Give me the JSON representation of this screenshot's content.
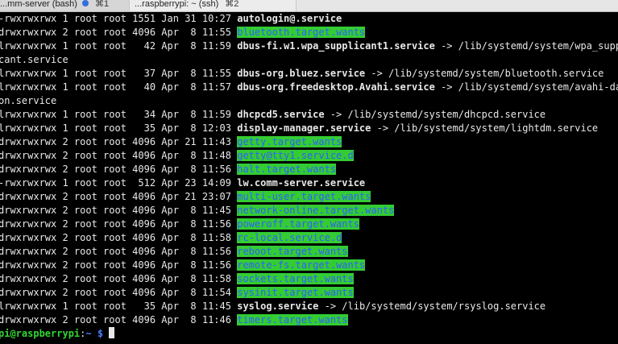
{
  "tabs": [
    {
      "title": "...mm-server (bash)",
      "shortcut": "⌘1"
    },
    {
      "title": "...raspberrypi: ~ (ssh)",
      "shortcut": "⌘2"
    }
  ],
  "colors": {
    "terminal_bg": "#000000",
    "text": "#e8e8e8",
    "dir_highlight": "#33cc33",
    "dir_text": "#2f5fff",
    "prompt_user": "#33d633",
    "prompt_path": "#4a7dff"
  },
  "lines": [
    {
      "prefix": "-rwxrwxrwx 1 root root 1551 Jan 31 10:27 ",
      "name": "autologin@.service",
      "type": "bold",
      "suffix": ""
    },
    {
      "prefix": "drwxrwxrwx 2 root root 4096 Apr  8 11:55 ",
      "name": "bluetooth.target.wants",
      "type": "dir",
      "suffix": ""
    },
    {
      "prefix": "lrwxrwxrwx 1 root root   42 Apr  8 11:59 ",
      "name": "dbus-fi.w1.wpa_supplicant1.service",
      "type": "link",
      "suffix": " -> /lib/systemd/system/wpa_suppli"
    },
    {
      "prefix": "cant.service",
      "name": "",
      "type": "plain",
      "suffix": ""
    },
    {
      "prefix": "lrwxrwxrwx 1 root root   37 Apr  8 11:55 ",
      "name": "dbus-org.bluez.service",
      "type": "link",
      "suffix": " -> /lib/systemd/system/bluetooth.service"
    },
    {
      "prefix": "lrwxrwxrwx 1 root root   40 Apr  8 11:57 ",
      "name": "dbus-org.freedesktop.Avahi.service",
      "type": "link",
      "suffix": " -> /lib/systemd/system/avahi-daem"
    },
    {
      "prefix": "on.service",
      "name": "",
      "type": "plain",
      "suffix": ""
    },
    {
      "prefix": "lrwxrwxrwx 1 root root   34 Apr  8 11:59 ",
      "name": "dhcpcd5.service",
      "type": "link",
      "suffix": " -> /lib/systemd/system/dhcpcd.service"
    },
    {
      "prefix": "lrwxrwxrwx 1 root root   35 Apr  8 12:03 ",
      "name": "display-manager.service",
      "type": "link",
      "suffix": " -> /lib/systemd/system/lightdm.service"
    },
    {
      "prefix": "drwxrwxrwx 2 root root 4096 Apr 21 11:43 ",
      "name": "getty.target.wants",
      "type": "dir",
      "suffix": ""
    },
    {
      "prefix": "drwxrwxrwx 2 root root 4096 Apr  8 11:48 ",
      "name": "getty@tty1.service.d",
      "type": "dir",
      "suffix": ""
    },
    {
      "prefix": "drwxrwxrwx 2 root root 4096 Apr  8 11:56 ",
      "name": "halt.target.wants",
      "type": "dir",
      "suffix": ""
    },
    {
      "prefix": "-rwxrwxrwx 1 root root  512 Apr 23 14:09 ",
      "name": "lw.comm-server.service",
      "type": "bold",
      "suffix": ""
    },
    {
      "prefix": "drwxrwxrwx 2 root root 4096 Apr 21 23:07 ",
      "name": "multi-user.target.wants",
      "type": "dir",
      "suffix": ""
    },
    {
      "prefix": "drwxrwxrwx 2 root root 4096 Apr  8 11:45 ",
      "name": "network-online.target.wants",
      "type": "dir",
      "suffix": ""
    },
    {
      "prefix": "drwxrwxrwx 2 root root 4096 Apr  8 11:56 ",
      "name": "poweroff.target.wants",
      "type": "dir",
      "suffix": ""
    },
    {
      "prefix": "drwxrwxrwx 2 root root 4096 Apr  8 11:58 ",
      "name": "rc-local.service.d",
      "type": "dir",
      "suffix": ""
    },
    {
      "prefix": "drwxrwxrwx 2 root root 4096 Apr  8 11:56 ",
      "name": "reboot.target.wants",
      "type": "dir",
      "suffix": ""
    },
    {
      "prefix": "drwxrwxrwx 2 root root 4096 Apr  8 11:56 ",
      "name": "remote-fs.target.wants",
      "type": "dir",
      "suffix": ""
    },
    {
      "prefix": "drwxrwxrwx 2 root root 4096 Apr  8 11:58 ",
      "name": "sockets.target.wants",
      "type": "dir",
      "suffix": ""
    },
    {
      "prefix": "drwxrwxrwx 2 root root 4096 Apr  8 11:54 ",
      "name": "sysinit.target.wants",
      "type": "dir",
      "suffix": ""
    },
    {
      "prefix": "lrwxrwxrwx 1 root root   35 Apr  8 11:45 ",
      "name": "syslog.service",
      "type": "link",
      "suffix": " -> /lib/systemd/system/rsyslog.service"
    },
    {
      "prefix": "drwxrwxrwx 2 root root 4096 Apr  8 11:46 ",
      "name": "timers.target.wants",
      "type": "dir",
      "suffix": ""
    }
  ],
  "prompt": {
    "user_host": "pi@raspberrypi",
    "sep": ":",
    "path": "~ $",
    "trail": " "
  }
}
